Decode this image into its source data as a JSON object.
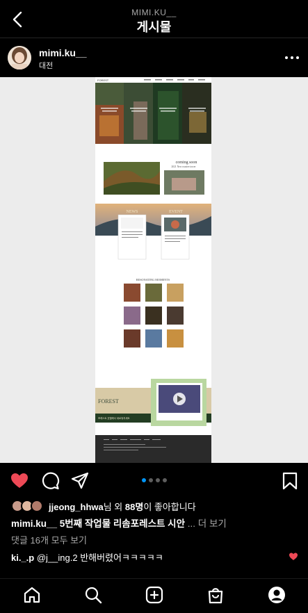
{
  "nav": {
    "subtitle": "MIMI.KU__",
    "title": "게시물"
  },
  "post": {
    "username": "mimi.ku__",
    "location": "대전",
    "carousel": {
      "count": 4,
      "active_index": 0
    }
  },
  "mockup": {
    "brand": "FOREST",
    "coming_soon": "coming soon",
    "coming_soon_sub": "2021 New roastee tower",
    "news_label": "NEWS",
    "event_label": "EVENT",
    "gallery_title": "RESONATING MOMENTS",
    "forest_label": "FOREST",
    "forest_caption": "포레스트 호텔에서 새로워지세요"
  },
  "likes": {
    "user": "jjeong_hhwa",
    "suffix_1": "님 외 ",
    "count": "88명",
    "suffix_2": "이 좋아합니다"
  },
  "caption": {
    "username": "mimi.ku__",
    "text": " 5번째 작업물 리솜포레스트 시안",
    "more": " ... 더 보기"
  },
  "comments_link": "댓글 16개 모두 보기",
  "comment": {
    "username": "ki._.p",
    "text": " @j__ing.2 반해버렸어ㅋㅋㅋㅋㅋ"
  },
  "colors": {
    "like_red": "#ed4956",
    "dot_active": "#0095f6"
  }
}
